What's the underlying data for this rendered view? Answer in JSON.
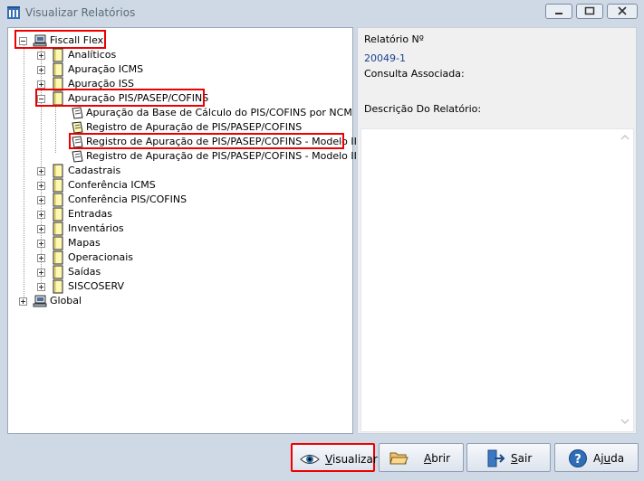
{
  "window": {
    "title": "Visualizar Relatórios"
  },
  "tree": {
    "root": "Fiscall Flex",
    "children": [
      "Analíticos",
      "Apuração ICMS",
      "Apuração ISS",
      "Apuração PIS/PASEP/COFINS"
    ],
    "pis_reports": [
      "Apuração da Base de Cálculo do PIS/COFINS por NCM",
      "Registro de Apuração de PIS/PASEP/COFINS",
      "Registro de Apuração de PIS/PASEP/COFINS - Modelo II",
      "Registro de Apuração de PIS/PASEP/COFINS - Modelo III"
    ],
    "more_children": [
      "Cadastrais",
      "Conferência ICMS",
      "Conferência PIS/COFINS",
      "Entradas",
      "Inventários",
      "Mapas",
      "Operacionais",
      "Saídas",
      "SISCOSERV"
    ],
    "global": "Global"
  },
  "details": {
    "report_number_label": "Relatório Nº",
    "report_number_value": "20049-1",
    "associated_query_label": "Consulta Associada:",
    "description_label": "Descrição Do Relatório:"
  },
  "buttons": {
    "visualizar_pre": "",
    "visualizar_ul": "V",
    "visualizar_post": "isualizar",
    "abrir_ul": "A",
    "abrir_post": "brir",
    "sair_ul": "S",
    "sair_post": "air",
    "ajuda_pre": "Aj",
    "ajuda_ul": "u",
    "ajuda_post": "da"
  }
}
